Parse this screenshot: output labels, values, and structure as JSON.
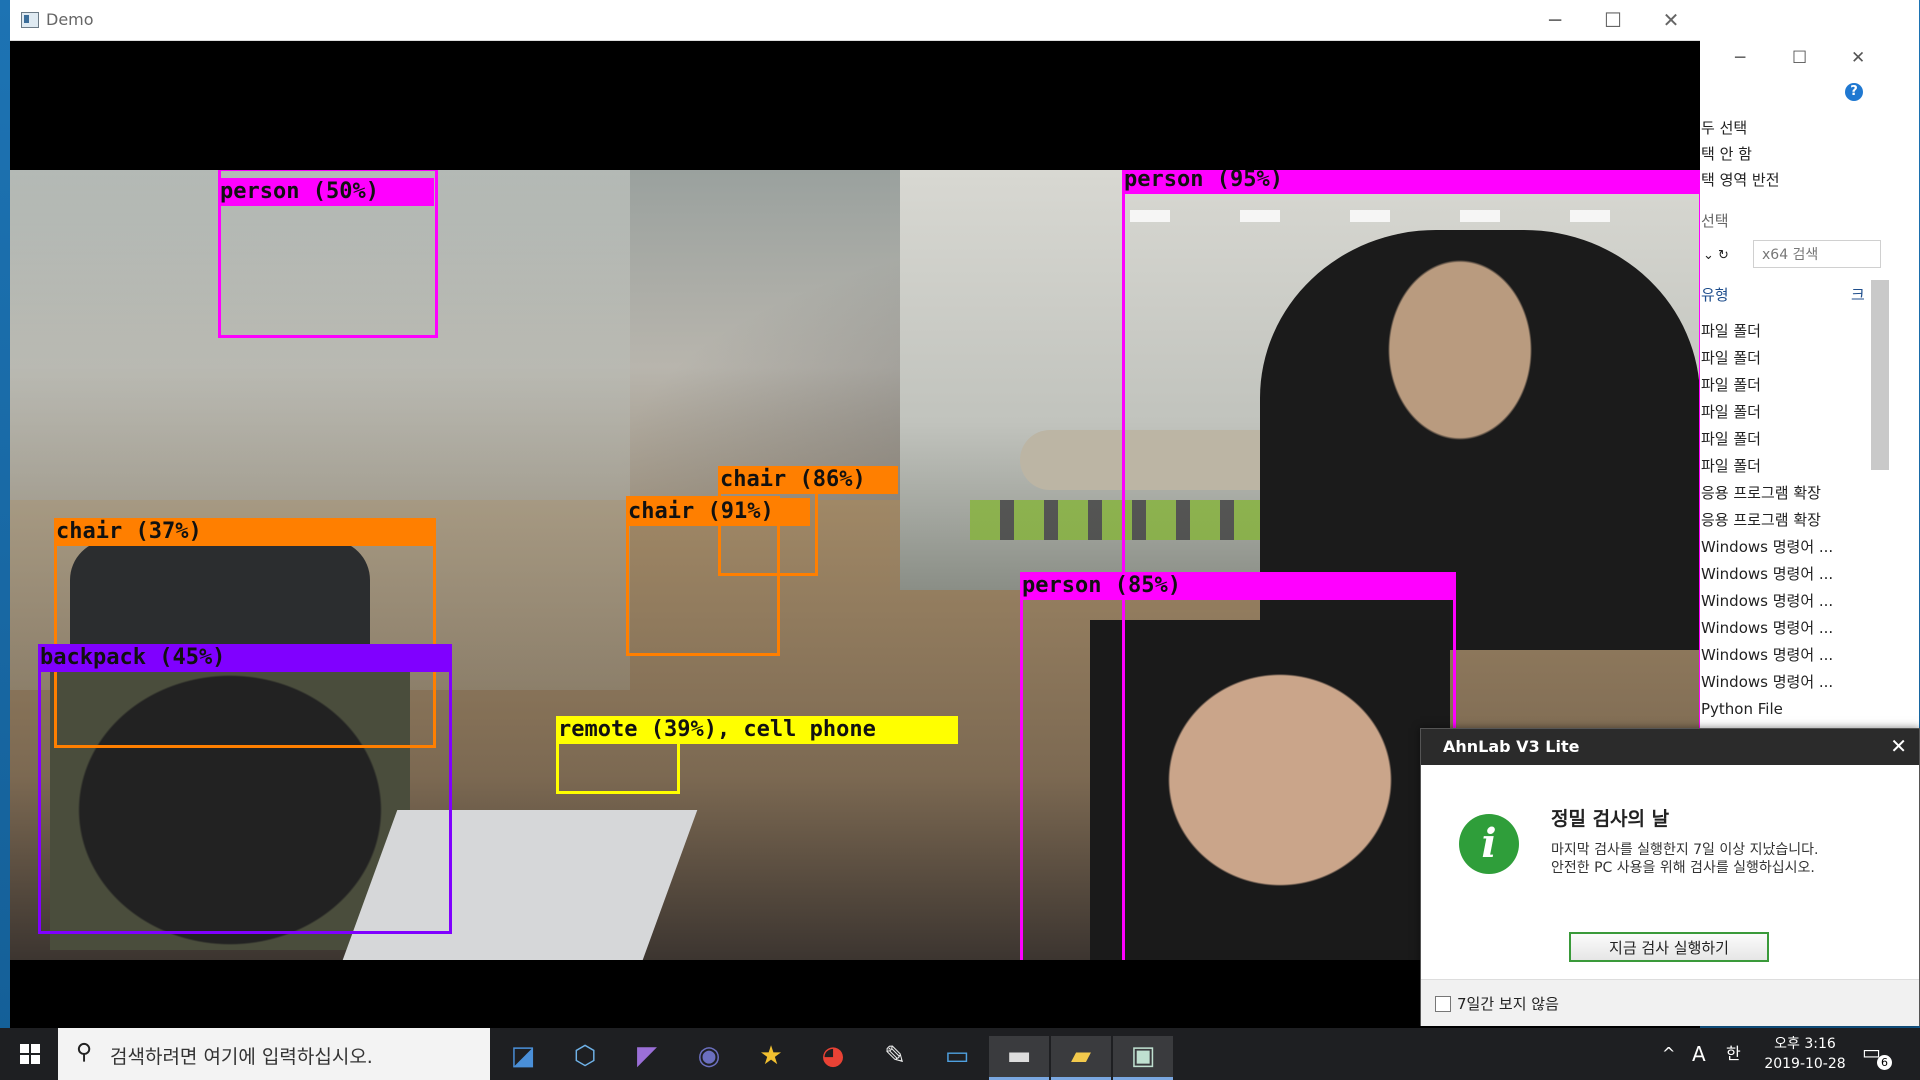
{
  "demo_window": {
    "title": "Demo",
    "minimize": "─",
    "maximize": "☐",
    "close": "✕"
  },
  "detections": [
    {
      "label": "person (50%)",
      "color": "#ff00ff"
    },
    {
      "label": "person (95%)",
      "color": "#ff00ff"
    },
    {
      "label": "chair (86%)",
      "color": "#ff7f00"
    },
    {
      "label": "chair (91%)",
      "color": "#ff7f00"
    },
    {
      "label": "chair (37%)",
      "color": "#ff7f00"
    },
    {
      "label": "backpack (45%)",
      "color": "#8000ff"
    },
    {
      "label": "person (85%)",
      "color": "#ff00ff"
    },
    {
      "label": "remote (39%), cell phone",
      "color": "#ffff00"
    }
  ],
  "explorer": {
    "min": "─",
    "max": "☐",
    "close": "✕",
    "chevron": "^",
    "help": "?",
    "ribbon": [
      "두 선택",
      "택 안 함",
      "택 영역 반전",
      "선택"
    ],
    "search_placeholder": "x64 검색",
    "col_type": "유형",
    "col_size": "크",
    "rows": [
      "파일 폴더",
      "파일 폴더",
      "파일 폴더",
      "파일 폴더",
      "파일 폴더",
      "파일 폴더",
      "응용 프로그램 확장",
      "응용 프로그램 확장",
      "Windows 명령어 ...",
      "Windows 명령어 ...",
      "Windows 명령어 ...",
      "Windows 명령어 ...",
      "Windows 명령어 ...",
      "Windows 명령어 ...",
      "Python File"
    ]
  },
  "ahnlab": {
    "title": "AhnLab V3 Lite",
    "close": "✕",
    "icon": "i",
    "heading": "정밀 검사의 날",
    "message_line1": "마지막 검사를 실행한지 7일 이상 지났습니다.",
    "message_line2": "안전한 PC 사용을 위해 검사를 실행하십시오.",
    "button": "지금 검사 실행하기",
    "checkbox_label": "7일간 보지 않음"
  },
  "taskbar": {
    "search_placeholder": "검색하려면 여기에 입력하십시오.",
    "pinned": [
      "pycharm-icon",
      "virtualbox-icon",
      "visual-studio-icon",
      "eclipse-icon",
      "star-app-icon",
      "chrome-icon",
      "paint-icon",
      "remote-desktop-icon",
      "terminal-icon",
      "file-explorer-icon",
      "demo-app-icon"
    ],
    "tray_chevron": "^",
    "ime_a": "A",
    "ime_han": "한",
    "time": "오후 3:16",
    "date": "2019-10-28",
    "notification_count": "6"
  }
}
